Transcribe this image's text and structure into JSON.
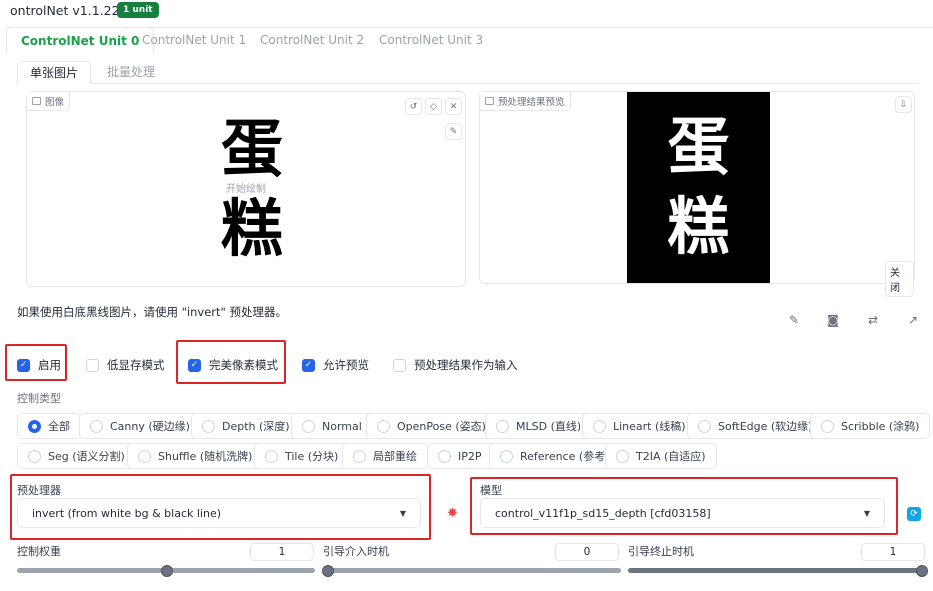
{
  "header": {
    "title": "ontrolNet v1.1.224",
    "badge": "1 unit"
  },
  "units": [
    "ControlNet Unit 0",
    "ControlNet Unit 1",
    "ControlNet Unit 2",
    "ControlNet Unit 3"
  ],
  "subtabs": [
    "单张图片",
    "批量处理"
  ],
  "image_panel": {
    "label": "图像",
    "hint": "开始绘制",
    "chars": [
      "蛋",
      "糕"
    ]
  },
  "preview_panel": {
    "label": "预处理结果预览",
    "close": "关闭",
    "chars": [
      "蛋",
      "糕"
    ]
  },
  "note": "如果使用白底黑线图片，请使用 \"invert\" 预处理器。",
  "checkboxes": [
    {
      "label": "启用",
      "checked": true
    },
    {
      "label": "低显存模式",
      "checked": false
    },
    {
      "label": "完美像素模式",
      "checked": true
    },
    {
      "label": "允许预览",
      "checked": true
    },
    {
      "label": "预处理结果作为输入",
      "checked": false
    }
  ],
  "control_type": {
    "label": "控制类型",
    "row1": [
      "全部",
      "Canny (硬边缘)",
      "Depth (深度)",
      "Normal",
      "OpenPose (姿态)",
      "MLSD (直线)",
      "Lineart (线稿)",
      "SoftEdge (软边缘)",
      "Scribble (涂鸦)"
    ],
    "row2": [
      "Seg (语义分割)",
      "Shuffle (随机洗牌)",
      "Tile (分块)",
      "局部重绘",
      "IP2P",
      "Reference (参考)",
      "T2IA (自适应)"
    ],
    "selected": "全部"
  },
  "preprocessor": {
    "label": "预处理器",
    "value": "invert (from white bg & black line)"
  },
  "model": {
    "label": "模型",
    "value": "control_v11f1p_sd15_depth [cfd03158]"
  },
  "sliders": [
    {
      "label": "控制权重",
      "value": "1",
      "fraction": 0.5
    },
    {
      "label": "引导介入时机",
      "value": "0",
      "fraction": 0.0
    },
    {
      "label": "引导终止时机",
      "value": "1",
      "fraction": 1.0
    }
  ],
  "colors": {
    "accent": "#2563eb",
    "green": "#16a34a",
    "highlight": "#dc2626"
  }
}
